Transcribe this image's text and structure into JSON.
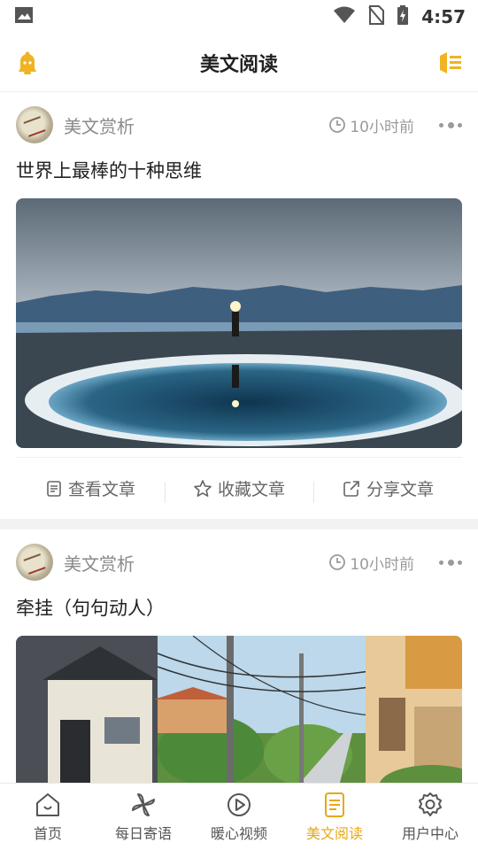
{
  "status_bar": {
    "time": "4:57"
  },
  "header": {
    "title": "美文阅读"
  },
  "colors": {
    "accent": "#f0b323",
    "text": "#222222",
    "muted": "#8a8a8a"
  },
  "feed": [
    {
      "source": "美文赏析",
      "time": "10小时前",
      "title": "世界上最棒的十种思维",
      "image": "person-with-headlamp-reflected-in-pool",
      "actions": [
        "查看文章",
        "收藏文章",
        "分享文章"
      ]
    },
    {
      "source": "美文赏析",
      "time": "10小时前",
      "title": "牵挂（句句动人）",
      "image": "residential-street-with-power-lines"
    }
  ],
  "tabs": [
    {
      "label": "首页",
      "icon": "home-icon",
      "active": false
    },
    {
      "label": "每日寄语",
      "icon": "pinwheel-icon",
      "active": false
    },
    {
      "label": "暖心视频",
      "icon": "play-circle-icon",
      "active": false
    },
    {
      "label": "美文阅读",
      "icon": "document-icon",
      "active": true
    },
    {
      "label": "用户中心",
      "icon": "settings-icon",
      "active": false
    }
  ]
}
